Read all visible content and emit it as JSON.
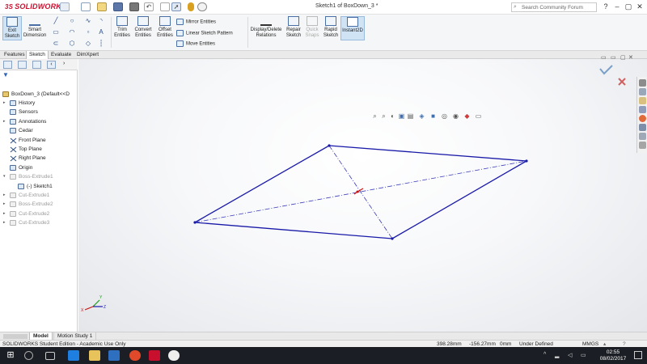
{
  "app": {
    "brand": "SOLIDWORKS",
    "document_title": "Sketch1 of BoxDown_3 *"
  },
  "search": {
    "placeholder": "Search Community Forum"
  },
  "ribbon": {
    "exit_sketch": "Exit Sketch",
    "smart_dimension": "Smart Dimension",
    "trim_entities": "Trim Entities",
    "convert_entities": "Convert Entities",
    "offset_entities": "Offset Entities",
    "mirror_entities": "Mirror Entities",
    "linear_sketch_pattern": "Linear Sketch Pattern",
    "move_entities": "Move Entities",
    "display_delete_relations": "Display/Delete Relations",
    "repair_sketch": "Repair Sketch",
    "quick_snaps": "Quick Snaps",
    "rapid_sketch": "Rapid Sketch",
    "instant2d": "Instant2D"
  },
  "tabs": [
    "Features",
    "Sketch",
    "Evaluate",
    "DimXpert"
  ],
  "tree": {
    "root": "BoxDown_3  (Default<<D",
    "items": [
      {
        "label": "History",
        "arrow": "▸"
      },
      {
        "label": "Sensors",
        "arrow": ""
      },
      {
        "label": "Annotations",
        "arrow": "▸"
      },
      {
        "label": "Cedar",
        "arrow": ""
      },
      {
        "label": "Front Plane",
        "arrow": ""
      },
      {
        "label": "Top Plane",
        "arrow": ""
      },
      {
        "label": "Right Plane",
        "arrow": ""
      },
      {
        "label": "Origin",
        "arrow": ""
      },
      {
        "label": "Boss-Extrude1",
        "arrow": "▾"
      },
      {
        "label": "(-) Sketch1",
        "arrow": ""
      },
      {
        "label": "Cut-Extrude1",
        "arrow": "▸"
      },
      {
        "label": "Boss-Extrude2",
        "arrow": "▸"
      },
      {
        "label": "Cut-Extrude2",
        "arrow": "▸"
      },
      {
        "label": "Cut-Extrude3",
        "arrow": "▸"
      }
    ]
  },
  "bottom_tabs": [
    "Model",
    "Motion Study 1"
  ],
  "status": {
    "edition": "SOLIDWORKS Student Edition - Academic Use Only",
    "x": "398.28mm",
    "y": "-156.27mm",
    "z": "0mm",
    "state": "Under Defined",
    "units": "MMGS"
  },
  "taskbar": {
    "time": "02:55",
    "date": "08/02/2017"
  },
  "colors": {
    "sketch_line": "#1a1aa8",
    "brand_red": "#c8102e",
    "ribbon_bg": "#f5f6f7"
  }
}
